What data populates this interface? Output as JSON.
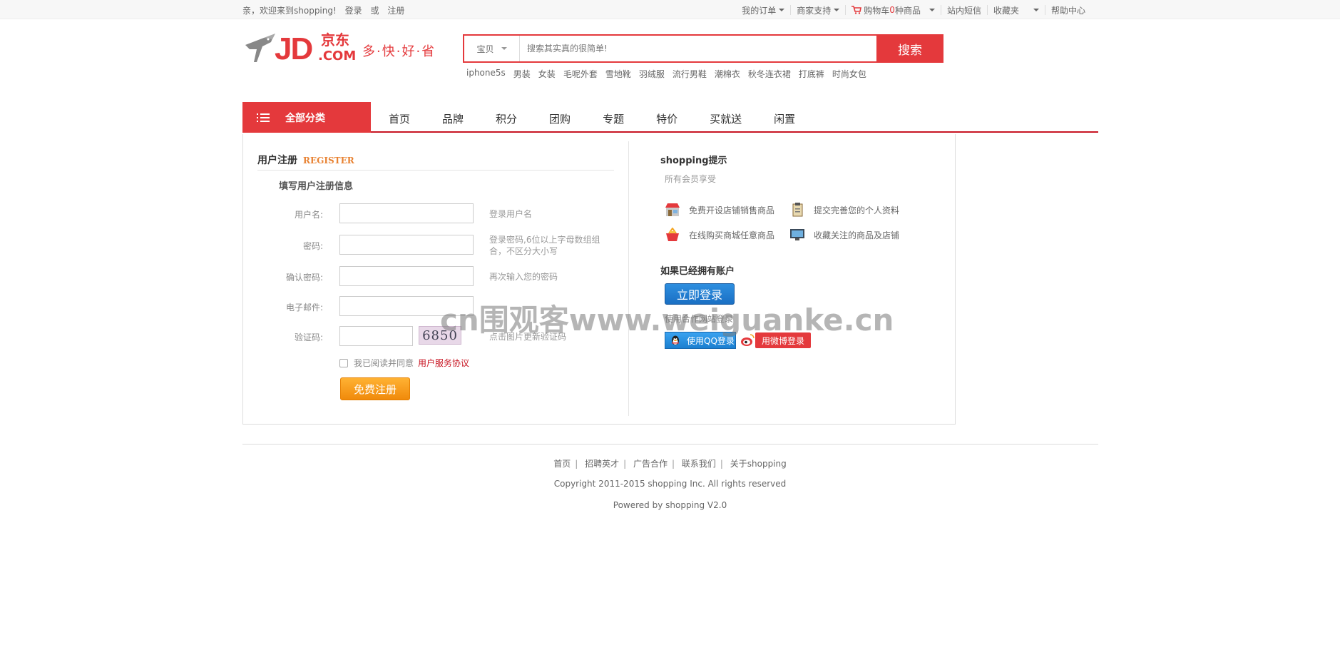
{
  "topbar": {
    "welcome": "亲，欢迎来到shopping!",
    "login": "登录",
    "or": "或",
    "register": "注册",
    "orders": "我的订单",
    "seller": "商家支持",
    "cart_prefix": "购物车",
    "cart_count": "0",
    "cart_suffix": "种商品",
    "messages": "站内短信",
    "favorites": "收藏夹",
    "help": "帮助中心"
  },
  "logo": {
    "brand": "JD",
    "brand_cn": "京东",
    "com": ".COM",
    "slogan": "多·快·好·省"
  },
  "search": {
    "category": "宝贝",
    "placeholder": "搜索其实真的很简单!",
    "button": "搜索"
  },
  "hotwords": [
    "iphone5s",
    "男装",
    "女装",
    "毛呢外套",
    "雪地靴",
    "羽绒服",
    "流行男鞋",
    "潮棉衣",
    "秋冬连衣裙",
    "打底裤",
    "时尚女包"
  ],
  "nav": {
    "all_categories": "全部分类",
    "links": [
      "首页",
      "品牌",
      "积分",
      "团购",
      "专题",
      "特价",
      "买就送",
      "闲置"
    ]
  },
  "register": {
    "title": "用户注册",
    "title_en": "REGISTER",
    "subtitle": "填写用户注册信息",
    "fields": [
      {
        "label": "用户名:",
        "tip": "登录用户名"
      },
      {
        "label": "密码:",
        "tip": "登录密码,6位以上字母数组组合，不区分大小写"
      },
      {
        "label": "确认密码:",
        "tip": "再次输入您的密码"
      },
      {
        "label": "电子邮件:",
        "tip": ""
      },
      {
        "label": "验证码:",
        "tip": "点击图片更新验证码"
      }
    ],
    "captcha": "6850",
    "agree_text": "我已阅读并同意",
    "agree_link": "用户服务协议",
    "submit": "免费注册"
  },
  "tips": {
    "title": "shopping提示",
    "subtitle": "所有会员享受",
    "perks": [
      "免费开设店铺销售商品",
      "提交完善您的个人资料",
      "在线购买商城任意商品",
      "收藏关注的商品及店铺"
    ],
    "have_account": "如果已经拥有账户",
    "login_button": "立即登录",
    "other_login": "使用合作网站登录",
    "qq_login": "使用QQ登录",
    "weibo_login": "用微博登录"
  },
  "watermark": "cn围观客www.weiguanke.cn",
  "footer": {
    "links": [
      "首页",
      "招聘英才",
      "广告合作",
      "联系我们",
      "关于shopping"
    ],
    "copyright": "Copyright 2011-2015 shopping Inc. All rights reserved",
    "powered": "Powered by shopping V2.0"
  },
  "colors": {
    "brand_red": "#e4393c",
    "register_orange": "#f08a0b",
    "login_blue": "#1a6fc3"
  }
}
